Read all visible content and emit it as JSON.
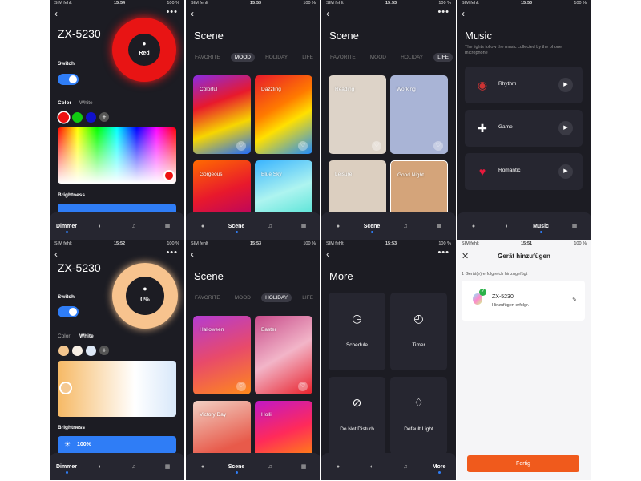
{
  "status": {
    "sim": "SIM fehlt",
    "battery": "100 %",
    "t1": "15:54",
    "t2": "15:53",
    "t3": "15:53",
    "t4": "15:53",
    "t5": "15:52",
    "t6": "15:53",
    "t7": "15:53",
    "t8": "15:51"
  },
  "nav": {
    "dimmer": "Dimmer",
    "scene": "Scene",
    "music": "Music",
    "more": "More"
  },
  "dimmer1": {
    "device": "ZX-5230",
    "switch": "Switch",
    "color": "Color",
    "white": "White",
    "brightness": "Brightness",
    "ring_label": "Red"
  },
  "dimmer2": {
    "device": "ZX-5230",
    "switch": "Switch",
    "color": "Color",
    "white": "White",
    "brightness": "Brightness",
    "ring_label": "0%",
    "brightness_value": "100%"
  },
  "scene_tabs": [
    "FAVORITE",
    "MOOD",
    "HOLIDAY",
    "LIFE"
  ],
  "scene_title": "Scene",
  "mood": [
    "Colorful",
    "Dazzling",
    "Gorgeous",
    "Blue Sky"
  ],
  "life": [
    "Reading",
    "Working",
    "Leisure",
    "Good Night"
  ],
  "holiday": [
    "Halloween",
    "Easter",
    "Victory Day",
    "Holli"
  ],
  "music": {
    "title": "Music",
    "subtitle": "The lights follow the music collected by the phone microphone",
    "items": [
      "Rhythm",
      "Game",
      "Romantic"
    ]
  },
  "more": {
    "title": "More",
    "items": [
      "Schedule",
      "Timer",
      "Do Not Disturb",
      "Default Light"
    ]
  },
  "add": {
    "title": "Gerät hinzufügen",
    "count": "1 Gerät(e) erfolgreich hinzugefügt",
    "device": "ZX-5230",
    "status": "Hinzufügen erfolgr.",
    "done": "Fertig"
  },
  "colors": {
    "accent": "#2f7df6",
    "bg": "#1c1c23",
    "orange": "#f05a1c"
  }
}
